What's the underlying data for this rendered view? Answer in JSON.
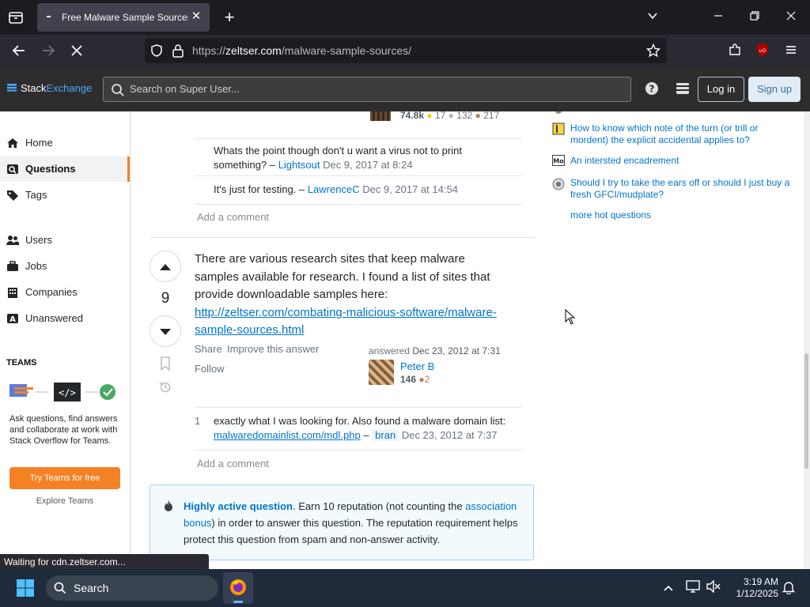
{
  "browser": {
    "tab_title": "Free Malware Sample Sources f",
    "url_prefix": "https://",
    "url_host": "zeltser.com",
    "url_path": "/malware-sample-sources/",
    "status": "Waiting for cdn.zeltser.com..."
  },
  "header": {
    "logo_stack": "Stack",
    "logo_exchange": "Exchange",
    "search_placeholder": "Search on Super User...",
    "login": "Log in",
    "signup": "Sign up"
  },
  "leftnav": {
    "items": [
      {
        "label": "Home"
      },
      {
        "label": "Questions"
      },
      {
        "label": "Tags"
      },
      {
        "label": "Users"
      },
      {
        "label": "Jobs"
      },
      {
        "label": "Companies"
      },
      {
        "label": "Unanswered"
      }
    ],
    "teams_heading": "TEAMS",
    "teams_blurb": "Ask questions, find answers and collaborate at work with Stack Overflow for Teams.",
    "try_teams": "Try Teams for free",
    "explore_teams": "Explore Teams"
  },
  "prev_post": {
    "rep": "74.8k",
    "gold": "17",
    "silver": "132",
    "bronze": "217",
    "comments": [
      {
        "text": "Whats the point though don't u want a virus not to print something? –",
        "user": "Lightsout",
        "date": "Dec 9, 2017 at 8:24"
      },
      {
        "text": "It's just for testing. –",
        "user": "LawrenceC",
        "date": "Dec 9, 2017 at 14:54"
      }
    ],
    "add_comment": "Add a comment"
  },
  "answer": {
    "score": "9",
    "body_text": "There are various research sites that keep malware samples available for research. I found a list of sites that provide downloadable samples here:",
    "body_link": "http://zeltser.com/combating-malicious-software/malware-sample-sources.html",
    "share": "Share",
    "improve": "Improve this answer",
    "follow": "Follow",
    "answered_label": "answered",
    "answered_date": "Dec 23, 2012 at 7:31",
    "user_name": "Peter B",
    "user_rep": "146",
    "user_bronze": "2",
    "comment_score": "1",
    "comment_text": "exactly what I was looking for. Also found a malware domain list:",
    "comment_link": "malwaredomainlist.com/mdl.php",
    "comment_dash": "–",
    "comment_user": "bran",
    "comment_date": "Dec 23, 2012 at 7:37",
    "add_comment": "Add a comment"
  },
  "notice": {
    "highlight": "Highly active question",
    "text1": ". Earn 10 reputation (not counting the ",
    "link": "association bonus",
    "text2": ") in order to answer this question. The reputation requirement helps protect this question from spam and non-answer activity."
  },
  "hot_questions": [
    {
      "title": "How to know which note of the turn (or trill or mordent) the explicit accidental applies to?",
      "icon": "music-icon"
    },
    {
      "title": "An intersted encadrement",
      "icon": "math-icon"
    },
    {
      "title": "Should I try to take the ears off or should I just buy a fresh GFCI/mudplate?",
      "icon": "diy-icon"
    }
  ],
  "more_hot": "more hot questions",
  "taskbar": {
    "search_label": "Search",
    "time": "3:19 AM",
    "date": "1/12/2025"
  }
}
